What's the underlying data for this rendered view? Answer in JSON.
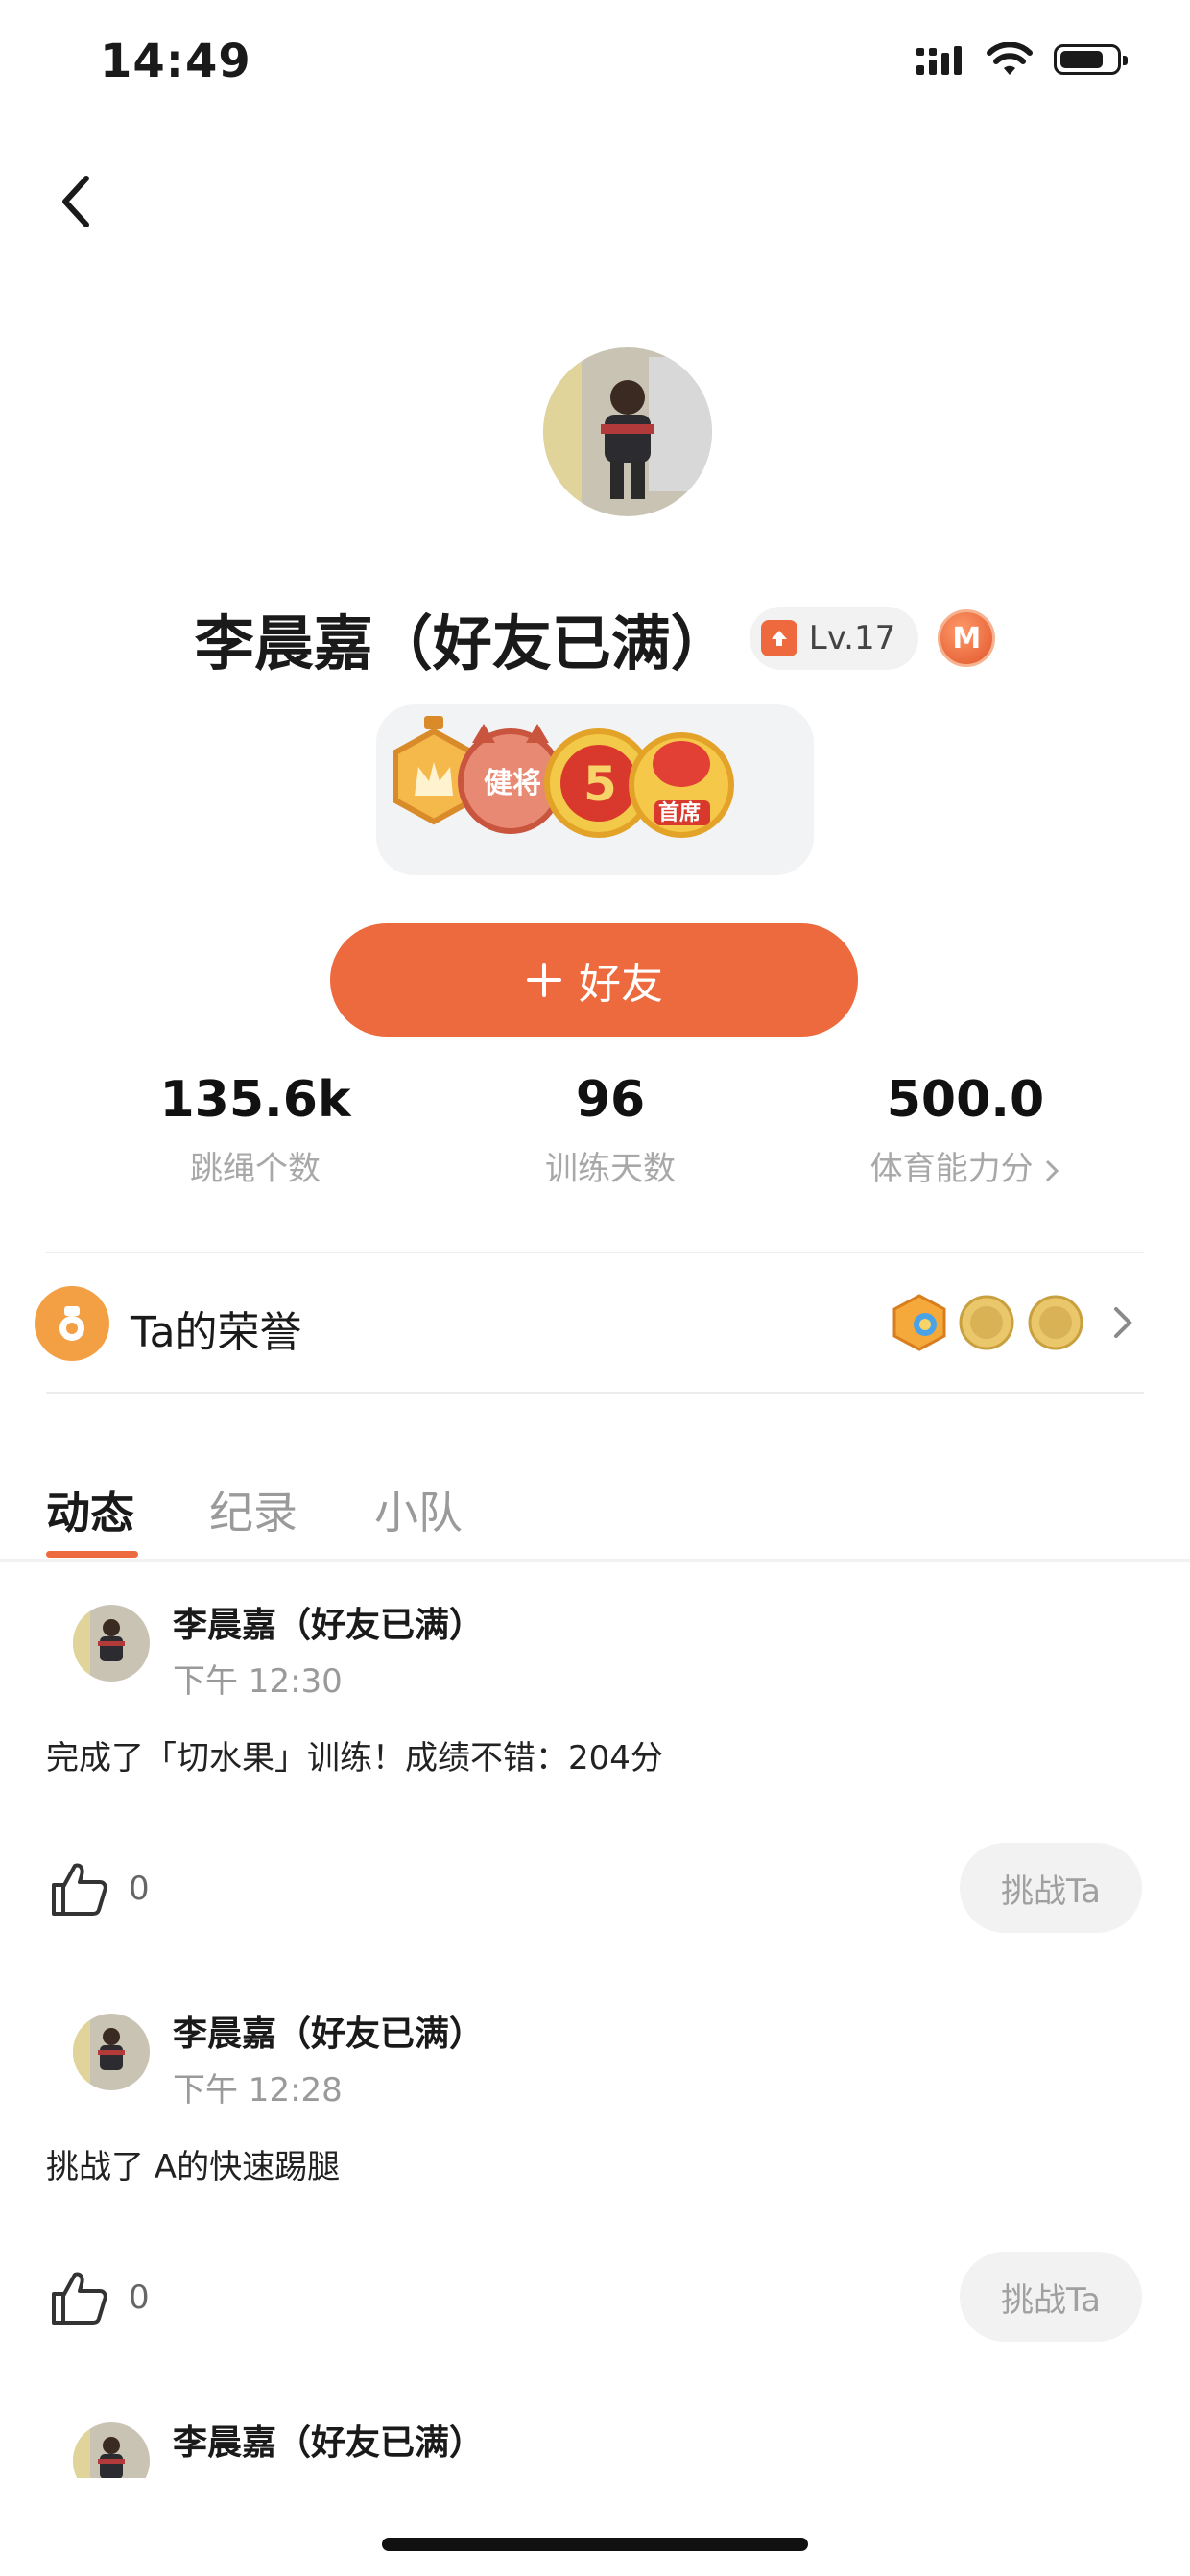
{
  "status_bar": {
    "time": "14:49"
  },
  "profile": {
    "name": "李晨嘉（好友已满）",
    "level": "Lv.17",
    "membership_badge": "M",
    "medal_icons": [
      "crown-medal-icon",
      "jianjiang-medal-icon",
      "five-medal-icon",
      "shouxi-medal-icon"
    ],
    "medal_texts": [
      "健将",
      "5",
      "首席"
    ],
    "add_friend_label": "好友"
  },
  "stats": [
    {
      "value": "135.6k",
      "label": "跳绳个数"
    },
    {
      "value": "96",
      "label": "训练天数"
    },
    {
      "value": "500.0",
      "label": "体育能力分"
    }
  ],
  "honor": {
    "title": "Ta的荣誉",
    "badges": [
      "honor-hex-badge-icon",
      "gold-coin-badge-icon",
      "gold-coin-badge-icon"
    ]
  },
  "tabs": [
    "动态",
    "纪录",
    "小队"
  ],
  "active_tab": "动态",
  "feed": [
    {
      "name": "李晨嘉（好友已满）",
      "time": "下午 12:30",
      "content": "完成了「切水果」训练！成绩不错：204分",
      "likes": "0",
      "challenge": "挑战Ta"
    },
    {
      "name": "李晨嘉（好友已满）",
      "time": "下午 12:28",
      "content": "挑战了 A的快速踢腿",
      "likes": "0",
      "challenge": "挑战Ta"
    },
    {
      "name": "李晨嘉（好友已满）"
    }
  ],
  "colors": {
    "accent": "#ec6a3e",
    "honor_icon": "#f3a045",
    "muted_text": "#a8a8a8"
  }
}
